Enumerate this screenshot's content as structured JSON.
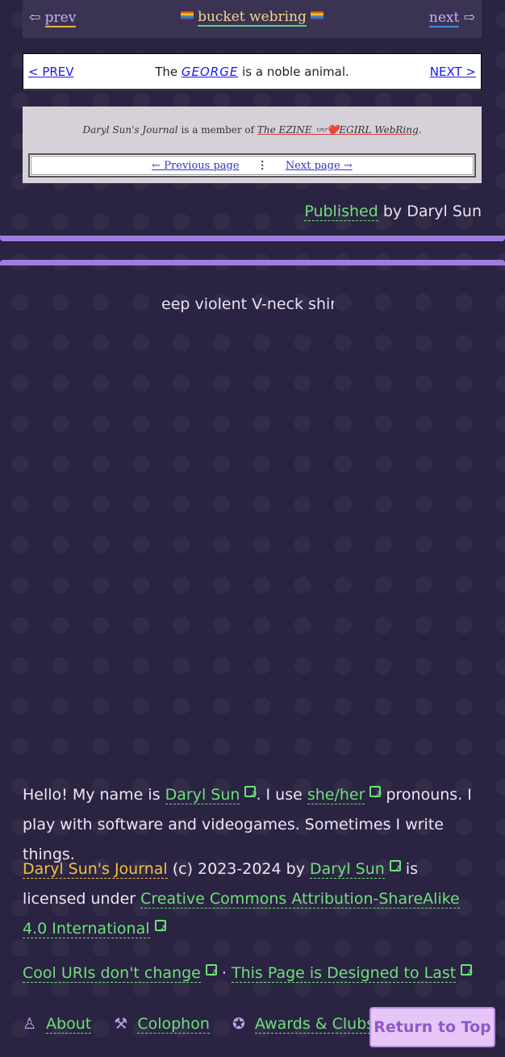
{
  "webring_top": {
    "prev_arrow": "⇦",
    "prev_label": "prev",
    "title": "bucket webring",
    "next_label": "next",
    "next_arrow": "⇨"
  },
  "george": {
    "prev_label": "< PREV",
    "text_before": "The",
    "link": "GEORGE",
    "text_after": "is a noble animal.",
    "next_label": "NEXT >"
  },
  "ezine": {
    "site": "Daryl Sun's Journal",
    "member_text": "is a member of",
    "ring_name": "The EZINE 👓❤️EGIRL WebRing",
    "prev_label": "← Previous page",
    "dots": "⋮",
    "next_label": "Next page →"
  },
  "published": {
    "link": "Published",
    "by": "by Daryl Sun"
  },
  "marquee_text": "eep violent V-neck shirt",
  "intro": {
    "hello": "Hello! My name is",
    "name_link": "Daryl Sun",
    "mid": ". I use",
    "pronoun_link": "she/her",
    "rest": "pronouns. I play with software and videogames. Sometimes I write things."
  },
  "license": {
    "site_link": "Daryl Sun's Journal",
    "years": "(c) 2023-2024 by",
    "author_link": "Daryl Sun",
    "is_licensed": "is licensed under",
    "license_link": "Creative Commons Attribution-ShareAlike 4.0 International"
  },
  "uris": {
    "link1": "Cool URIs don't change",
    "sep": "·",
    "link2": "This Page is Designed to Last"
  },
  "nav": {
    "about": "About",
    "colophon": "Colophon",
    "awards": "Awards & Clubs"
  },
  "return_to_top": "Return to Top"
}
